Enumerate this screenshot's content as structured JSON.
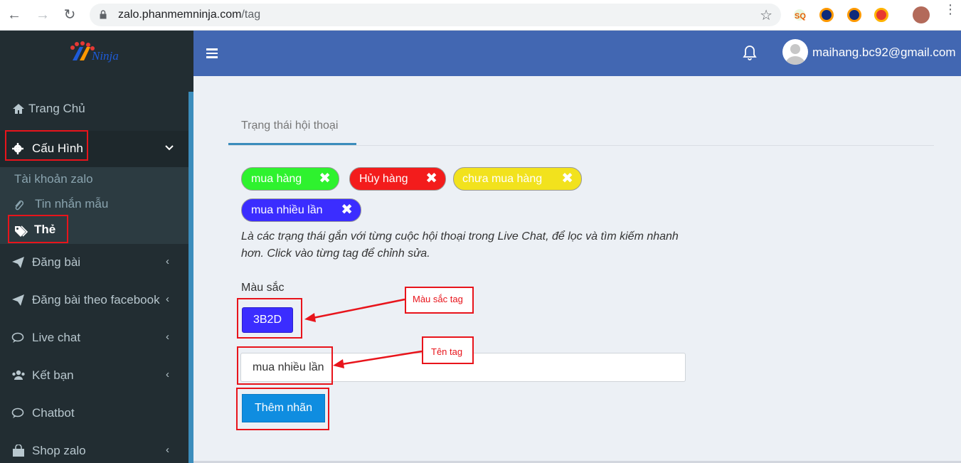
{
  "browser": {
    "url_host": "zalo.phanmemninja.com",
    "url_path": "/tag"
  },
  "header": {
    "user_email": "maihang.bc92@gmail.com"
  },
  "sidebar": {
    "items": [
      {
        "label": "Trang Chủ",
        "icon": "home-icon"
      },
      {
        "label": "Cấu Hình",
        "icon": "gear-icon",
        "expanded": true
      },
      {
        "label": "Đăng bài",
        "icon": "paper-plane-icon"
      },
      {
        "label": "Đăng bài theo facebook",
        "icon": "paper-plane-icon"
      },
      {
        "label": "Live chat",
        "icon": "chat-bubble-icon"
      },
      {
        "label": "Kết bạn",
        "icon": "users-icon"
      },
      {
        "label": "Chatbot",
        "icon": "chat-bubble-icon"
      },
      {
        "label": "Shop zalo",
        "icon": "shopping-bag-icon"
      }
    ],
    "sub_items": [
      {
        "label": "Tài khoản zalo"
      },
      {
        "label": "Tin nhắn mẫu",
        "icon": "paperclip-icon"
      },
      {
        "label": "Thẻ",
        "icon": "tags-icon"
      }
    ]
  },
  "main": {
    "tab_label": "Trạng thái hội thoại",
    "tags": [
      {
        "label": "mua hàng",
        "color": "#2ef22e",
        "text_color": "#ffffff"
      },
      {
        "label": "Hủy hàng",
        "color": "#f31c1c",
        "text_color": "#ffffff"
      },
      {
        "label": "chưa mua hàng",
        "color": "#f2e21d",
        "text_color": "#ffffff"
      },
      {
        "label": "mua nhiều lần",
        "color": "#3b2dff",
        "text_color": "#ffffff"
      }
    ],
    "description": "Là các trạng thái gắn với từng cuộc hội thoại trong Live Chat, để lọc và tìm kiếm nhanh hơn. Click vào từng tag để chỉnh sửa.",
    "color_label": "Màu sắc",
    "color_value": "3B2D",
    "color_swatch": "#3b2dff",
    "name_value": "mua nhiều lần",
    "submit_label": "Thêm nhãn"
  },
  "annotations": {
    "color_tag_label": "Màu sắc tag",
    "tag_name_label": "Tên tag"
  },
  "colors": {
    "sidebar_bg": "#222d32",
    "header_bg": "#4267b2",
    "annotation_red": "#e8141b",
    "primary_button": "#0f8de0"
  }
}
